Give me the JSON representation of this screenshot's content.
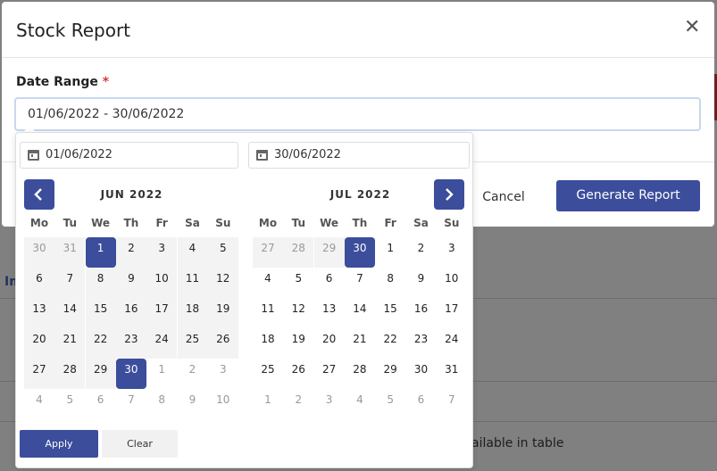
{
  "modal": {
    "title": "Stock Report",
    "close_icon": "close-icon",
    "date_range_label": "Date Range",
    "required_mark": "*",
    "date_range_value": "01/06/2022 - 30/06/2022",
    "cancel_label": "Cancel",
    "generate_label": "Generate Report"
  },
  "background": {
    "partial_heading": "Im",
    "partial_text": "ailable in table"
  },
  "picker": {
    "start_input": "01/06/2022",
    "end_input": "30/06/2022",
    "weekdays": [
      "Mo",
      "Tu",
      "We",
      "Th",
      "Fr",
      "Sa",
      "Su"
    ],
    "left_month": "JUN 2022",
    "right_month": "JUL 2022",
    "left_days": [
      [
        "30",
        "31",
        "1",
        "2",
        "3",
        "4",
        "5"
      ],
      [
        "6",
        "7",
        "8",
        "9",
        "10",
        "11",
        "12"
      ],
      [
        "13",
        "14",
        "15",
        "16",
        "17",
        "18",
        "19"
      ],
      [
        "20",
        "21",
        "22",
        "23",
        "24",
        "25",
        "26"
      ],
      [
        "27",
        "28",
        "29",
        "30",
        "1",
        "2",
        "3"
      ],
      [
        "4",
        "5",
        "6",
        "7",
        "8",
        "9",
        "10"
      ]
    ],
    "right_days": [
      [
        "27",
        "28",
        "29",
        "30",
        "1",
        "2",
        "3"
      ],
      [
        "4",
        "5",
        "6",
        "7",
        "8",
        "9",
        "10"
      ],
      [
        "11",
        "12",
        "13",
        "14",
        "15",
        "16",
        "17"
      ],
      [
        "18",
        "19",
        "20",
        "21",
        "22",
        "23",
        "24"
      ],
      [
        "25",
        "26",
        "27",
        "28",
        "29",
        "30",
        "31"
      ],
      [
        "1",
        "2",
        "3",
        "4",
        "5",
        "6",
        "7"
      ]
    ],
    "apply_label": "Apply",
    "clear_label": "Clear",
    "accent_color": "#3b4d9b"
  }
}
